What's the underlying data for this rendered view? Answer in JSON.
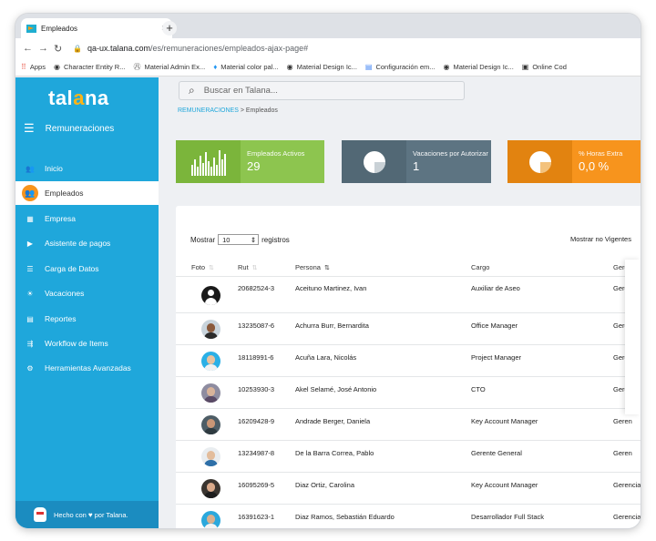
{
  "browser": {
    "tab_title": "Empleados",
    "url_host": "qa-ux.talana.com",
    "url_path": "/es/remuneraciones/empleados-ajax-page#",
    "bookmarks": [
      "Apps",
      "Character Entity R...",
      "Material Admin Ex...",
      "Material color pal...",
      "Material Design Ic...",
      "Configuración em...",
      "Material Design Ic...",
      "Online Cod"
    ]
  },
  "sidebar": {
    "logo_pre": "tal",
    "logo_o": "a",
    "logo_post": "na",
    "module": "Remuneraciones",
    "items": [
      {
        "label": "Inicio",
        "icon": "people-icon"
      },
      {
        "label": "Empleados",
        "icon": "employees-icon"
      },
      {
        "label": "Empresa",
        "icon": "building-icon"
      },
      {
        "label": "Asistente de pagos",
        "icon": "play-icon"
      },
      {
        "label": "Carga de Datos",
        "icon": "list-icon"
      },
      {
        "label": "Vacaciones",
        "icon": "sun-icon"
      },
      {
        "label": "Reportes",
        "icon": "report-icon"
      },
      {
        "label": "Workflow de Items",
        "icon": "workflow-icon"
      },
      {
        "label": "Herramientas Avanzadas",
        "icon": "gear-icon"
      }
    ],
    "footer_pre": "Hecho con",
    "footer_post": "por Talana."
  },
  "search": {
    "placeholder": "Buscar en Talana..."
  },
  "breadcrumb": {
    "link": "REMUNERACIONES",
    "sep": " > ",
    "current": "Empleados"
  },
  "cards": [
    {
      "label": "Empleados Activos",
      "value": "29"
    },
    {
      "label": "Vacaciones por Autorizar",
      "value": "1"
    },
    {
      "label": "% Horas Extra",
      "value": "0,0 %"
    }
  ],
  "table": {
    "show_pre": "Mostrar",
    "show_value": "10",
    "show_post": "registros",
    "show_inactive": "Mostrar no Vigentes",
    "headers": [
      "Foto",
      "Rut",
      "Persona",
      "Cargo",
      "Gerencia"
    ],
    "rows": [
      {
        "rut": "20682524-3",
        "persona": "Aceituno Martinez, Ivan",
        "cargo": "Auxiliar de Aseo",
        "gerencia": "Gerencia"
      },
      {
        "rut": "13235087-6",
        "persona": "Achurra Burr, Bernardita",
        "cargo": "Office Manager",
        "gerencia": "Gerenc"
      },
      {
        "rut": "18118991-6",
        "persona": "Acuña Lara, Nicolás",
        "cargo": "Project Manager",
        "gerencia": "Gerenc"
      },
      {
        "rut": "10253930-3",
        "persona": "Akel Selamé, José Antonio",
        "cargo": "CTO",
        "gerencia": "Geren"
      },
      {
        "rut": "16209428-9",
        "persona": "Andrade Berger, Daniela",
        "cargo": "Key Account Manager",
        "gerencia": "Geren"
      },
      {
        "rut": "13234987-8",
        "persona": "De la Barra Correa, Pablo",
        "cargo": "Gerente General",
        "gerencia": "Geren"
      },
      {
        "rut": "16095269-5",
        "persona": "Diaz Ortiz, Carolina",
        "cargo": "Key Account Manager",
        "gerencia": "Gerencia"
      },
      {
        "rut": "16391623-1",
        "persona": "Diaz Ramos, Sebastián Eduardo",
        "cargo": "Desarrollador Full Stack",
        "gerencia": "Gerencia"
      }
    ]
  },
  "colors": {
    "sidebar": "#1fa7db",
    "accent": "#f7941d",
    "green": "#8dc54f",
    "slate": "#5d7482"
  }
}
